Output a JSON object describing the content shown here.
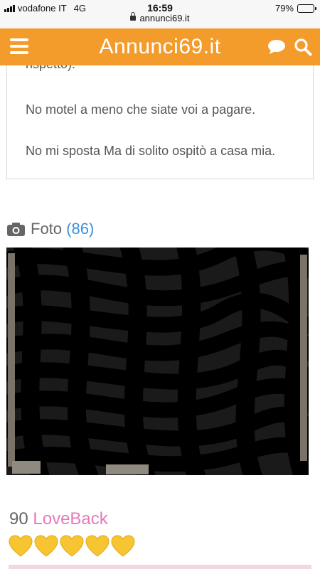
{
  "status_bar": {
    "carrier": "vodafone IT",
    "network": "4G",
    "time": "16:59",
    "url": "annunci69.it",
    "battery_text": "79%",
    "battery_level": 0.79
  },
  "header": {
    "title": "Annunci69.it",
    "menu_icon": "hamburger-menu-icon",
    "chat_icon": "chat-bubble-icon",
    "search_icon": "search-icon",
    "color": "#f39c2c"
  },
  "description": {
    "cut_text": "rispetto).",
    "paragraphs": [
      "No motel a meno che siate voi a pagare.",
      "No mi sposta Ma di solito ospitò a casa mia."
    ]
  },
  "photos": {
    "label": "Foto",
    "count_open": "(",
    "count": "86",
    "count_close": ")",
    "camera_icon": "camera-icon"
  },
  "loveback": {
    "count": "90",
    "label": "LoveBack",
    "hearts": 5,
    "heart_icon": "yellow-heart-icon",
    "heart_color": "#f7c531",
    "label_color": "#e57ab8"
  }
}
